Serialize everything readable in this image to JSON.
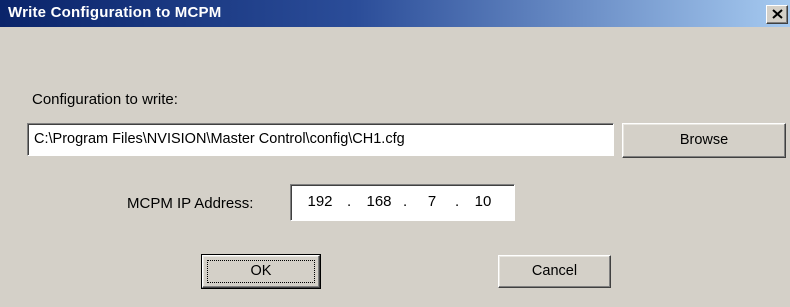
{
  "window": {
    "title": "Write Configuration to MCPM",
    "close_icon": "close-icon"
  },
  "config": {
    "label": "Configuration to write:",
    "path_value": "C:\\Program Files\\NVISION\\Master Control\\config\\CH1.cfg",
    "browse_label": "Browse"
  },
  "ip": {
    "label": "MCPM IP Address:",
    "octets": [
      "192",
      "168",
      "7",
      "10"
    ],
    "separator": "."
  },
  "buttons": {
    "ok_label": "OK",
    "cancel_label": "Cancel"
  },
  "colors": {
    "title_bar_start": "#0a246a",
    "title_bar_end": "#a6caf0",
    "dialog_face": "#d4d0c8"
  }
}
